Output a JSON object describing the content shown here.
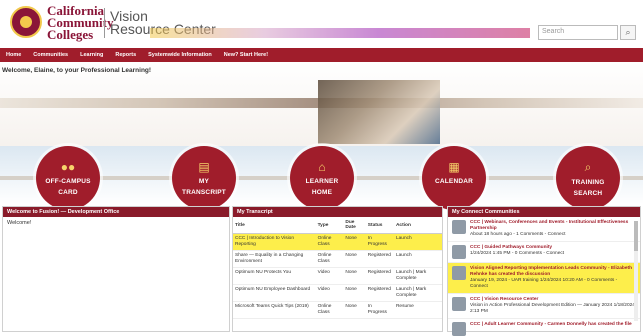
{
  "header": {
    "logo_line1": "California",
    "logo_line2": "Community",
    "logo_line3": "Colleges",
    "site_title_line1": "Vision",
    "site_title_line2": "Resource Center",
    "search_placeholder": "Search",
    "search_icon": "search-icon"
  },
  "nav": {
    "items": [
      "Home",
      "Communities",
      "Learning",
      "Reports",
      "Systemwide Information",
      "New? Start Here!"
    ]
  },
  "welcome": "Welcome, Elaine, to your Professional Learning!",
  "tiles": [
    {
      "label1": "OFF-CAMPUS",
      "label2": "CARD",
      "icon": "group-icon"
    },
    {
      "label1": "MY",
      "label2": "TRANSCRIPT",
      "icon": "document-icon"
    },
    {
      "label1": "LEARNER",
      "label2": "HOME",
      "icon": "home-icon"
    },
    {
      "label1": "CALENDAR",
      "label2": "",
      "icon": "calendar-icon"
    },
    {
      "label1": "TRAINING",
      "label2": "SEARCH",
      "icon": "search-icon"
    }
  ],
  "panel1": {
    "title": "Welcome to Fusion! — Development Office",
    "body": "Welcome!"
  },
  "panel2": {
    "title": "My Transcript",
    "headers": [
      "Title",
      "Type",
      "Due Date",
      "Status",
      "Action"
    ],
    "rows": [
      {
        "title": "CCC | Introduction to Vision Reporting",
        "type": "Online Class",
        "due": "None",
        "status": "In Progress",
        "action": "Launch",
        "highlight": true
      },
      {
        "title": "Share — Equality in a Changing Environment",
        "type": "Online Class",
        "due": "None",
        "status": "Registered",
        "action": "Launch",
        "highlight": false
      },
      {
        "title": "Optimum NU Protects You",
        "type": "Video",
        "due": "None",
        "status": "Registered",
        "action": "Launch | Mark Complete",
        "highlight": false
      },
      {
        "title": "Optimum NU Employee Dashboard",
        "type": "Video",
        "due": "None",
        "status": "Registered",
        "action": "Launch | Mark Complete",
        "highlight": false
      },
      {
        "title": "Microsoft Teams Quick Tips (2019)",
        "type": "Online Class",
        "due": "None",
        "status": "In Progress",
        "action": "Resume",
        "highlight": false
      }
    ]
  },
  "panel3": {
    "title": "My Connect Communities",
    "items": [
      {
        "title": "CCC | Webinars, Conferences and Events - Institutional Effectiveness Partnership",
        "meta": "About 18 hours ago - 1 Comments - Connect",
        "highlight": false
      },
      {
        "title": "CCC | Guided Pathways Community",
        "meta": "1/24/2024 1:45 PM - 0 Comments - Connect",
        "highlight": false
      },
      {
        "title": "Vision Aligned Reporting Implementation Leads Community - Elizabeth Rehnke has created the discussion",
        "meta": "January 19, 2024 - UAR training 1/24/2024 10:20 AM - 0 Comments - Connect",
        "highlight": true
      },
      {
        "title": "CCC | Vision Resource Center",
        "meta": "Vision in Action Professional Development Edition — January 2024 1/18/2024 2:13 PM",
        "highlight": false
      },
      {
        "title": "CCC | Adult Learner Community - Carmen Donnelly has created the file",
        "meta": "",
        "highlight": false
      }
    ]
  },
  "colors": {
    "brand": "#a01d2b",
    "gold": "#f2c94c",
    "highlight": "#fdee4b"
  }
}
